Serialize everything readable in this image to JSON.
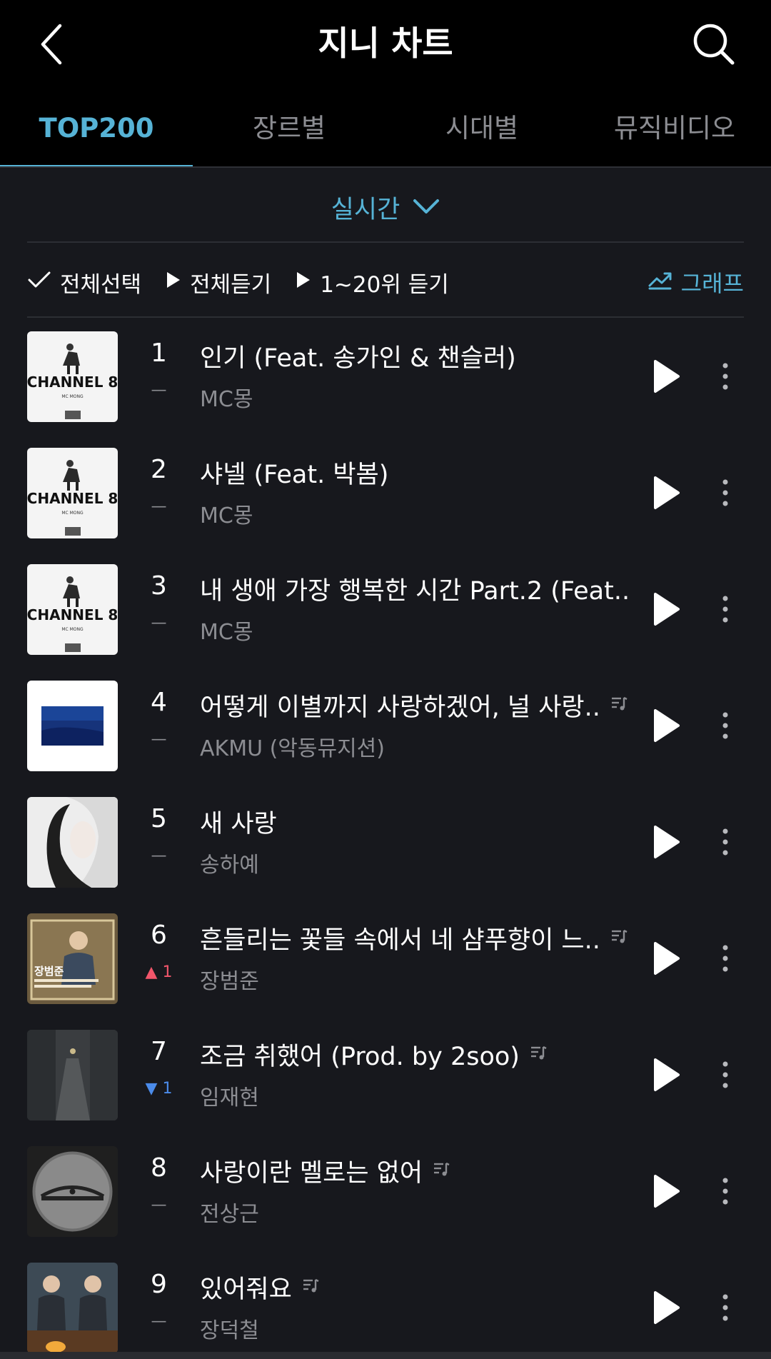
{
  "header": {
    "title": "지니 차트"
  },
  "tabs": [
    {
      "label": "TOP200",
      "active": true
    },
    {
      "label": "장르별",
      "active": false
    },
    {
      "label": "시대별",
      "active": false
    },
    {
      "label": "뮤직비디오",
      "active": false
    }
  ],
  "period": {
    "label": "실시간"
  },
  "toolbar": {
    "select_all": "전체선택",
    "play_all": "전체듣기",
    "play_top20": "1~20위 듣기",
    "graph": "그래프"
  },
  "colors": {
    "accent": "#56b3d6",
    "up": "#f2566b",
    "down": "#4b8bea",
    "background": "#17181d"
  },
  "songs": [
    {
      "rank": "1",
      "change": "—",
      "title": "인기 (Feat. 송가인 & 챈슬러)",
      "artist": "MC몽",
      "lyrics_icon": false
    },
    {
      "rank": "2",
      "change": "—",
      "title": "샤넬 (Feat. 박봄)",
      "artist": "MC몽",
      "lyrics_icon": false
    },
    {
      "rank": "3",
      "change": "—",
      "title": "내 생애 가장 행복한 시간 Part.2 (Feat...",
      "artist": "MC몽",
      "lyrics_icon": false
    },
    {
      "rank": "4",
      "change": "—",
      "title": "어떻게 이별까지 사랑하겠어, 널 사랑..",
      "artist": "AKMU (악동뮤지션)",
      "lyrics_icon": true
    },
    {
      "rank": "5",
      "change": "—",
      "title": "새 사랑",
      "artist": "송하예",
      "lyrics_icon": false
    },
    {
      "rank": "6",
      "change": "▲ 1",
      "title": "흔들리는 꽃들 속에서 네 샴푸향이 느..",
      "artist": "장범준",
      "lyrics_icon": true
    },
    {
      "rank": "7",
      "change": "▼ 1",
      "title": "조금 취했어 (Prod. by 2soo)",
      "artist": "임재현",
      "lyrics_icon": true
    },
    {
      "rank": "8",
      "change": "—",
      "title": "사랑이란 멜로는 없어",
      "artist": "전상근",
      "lyrics_icon": true
    },
    {
      "rank": "9",
      "change": "—",
      "title": "있어줘요",
      "artist": "장덕철",
      "lyrics_icon": true
    }
  ],
  "covers": [
    {
      "text": "CHANNEL 8",
      "subtext": "MC MONG"
    },
    {
      "text": "CHANNEL 8",
      "subtext": "MC MONG"
    },
    {
      "text": "CHANNEL 8",
      "subtext": "MC MONG"
    },
    {
      "text": "",
      "subtext": ""
    },
    {
      "text": "",
      "subtext": ""
    },
    {
      "text": "장범준",
      "subtext": ""
    },
    {
      "text": "",
      "subtext": ""
    },
    {
      "text": "",
      "subtext": ""
    },
    {
      "text": "",
      "subtext": ""
    }
  ]
}
